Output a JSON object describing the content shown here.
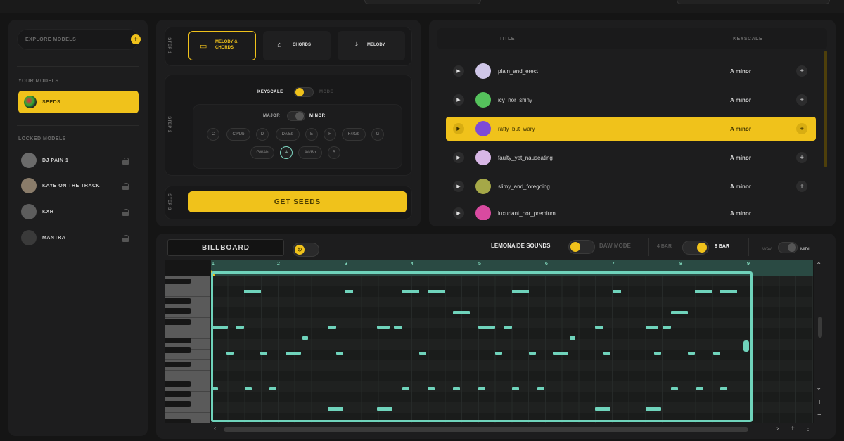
{
  "sidebar": {
    "explore_label": "EXPLORE MODELS",
    "your_models_label": "YOUR MODELS",
    "selected_model": "SEEDS",
    "locked_models_label": "LOCKED MODELS",
    "locked_models": [
      "DJ PAIN 1",
      "KAYE ON THE TRACK",
      "KXH",
      "MANTRA"
    ]
  },
  "steps": {
    "step1_label": "STEP 1",
    "step2_label": "STEP 2",
    "step3_label": "STEP 3",
    "modes": [
      "MELODY & CHORDS",
      "CHORDS",
      "MELODY"
    ],
    "keyscale_label": "KEYSCALE",
    "mode_label": "MODE",
    "major_label": "MAJOR",
    "minor_label": "MINOR",
    "keys_row1": [
      "C",
      "C#/Db",
      "D",
      "D#/Eb",
      "E",
      "F",
      "F#/Gb",
      "G"
    ],
    "keys_row2": [
      "G#/Ab",
      "A",
      "A#/Bb",
      "B"
    ],
    "selected_key": "A",
    "get_seeds": "GET SEEDS"
  },
  "results": {
    "col_title": "TITLE",
    "col_keyscale": "KEYSCALE",
    "rows": [
      {
        "title": "plain_and_erect",
        "key": "A minor",
        "avatar": "#cfc6e8"
      },
      {
        "title": "icy_nor_shiny",
        "key": "A minor",
        "avatar": "#55c25c"
      },
      {
        "title": "ratty_but_wary",
        "key": "A minor",
        "avatar": "#7e4ad6"
      },
      {
        "title": "faulty_yet_nauseating",
        "key": "A minor",
        "avatar": "#d8b7e6"
      },
      {
        "title": "slimy_and_foregoing",
        "key": "A minor",
        "avatar": "#a5a848"
      },
      {
        "title": "luxuriant_nor_premium",
        "key": "A minor",
        "avatar": "#d94aa0"
      }
    ],
    "selected_index": 2
  },
  "editor": {
    "title": "BILLBOARD",
    "lemonaide_sounds": "LEMONAIDE SOUNDS",
    "daw_mode": "DAW MODE",
    "bar4": "4 BAR",
    "bar8": "8 BAR",
    "wav": "WAV",
    "midi": "MIDI",
    "ruler": [
      "1",
      "2",
      "3",
      "4",
      "5",
      "6",
      "7",
      "8",
      "9"
    ]
  },
  "colors": {
    "accent": "#f0c21b",
    "note": "#6fd3bb",
    "bg": "#151515"
  },
  "icons": [
    "plus-icon",
    "lock-icon",
    "play-icon",
    "piano-icon",
    "refresh-icon",
    "chevron-up-icon",
    "chevron-down-icon",
    "zoom-in-icon",
    "zoom-out-icon"
  ]
}
